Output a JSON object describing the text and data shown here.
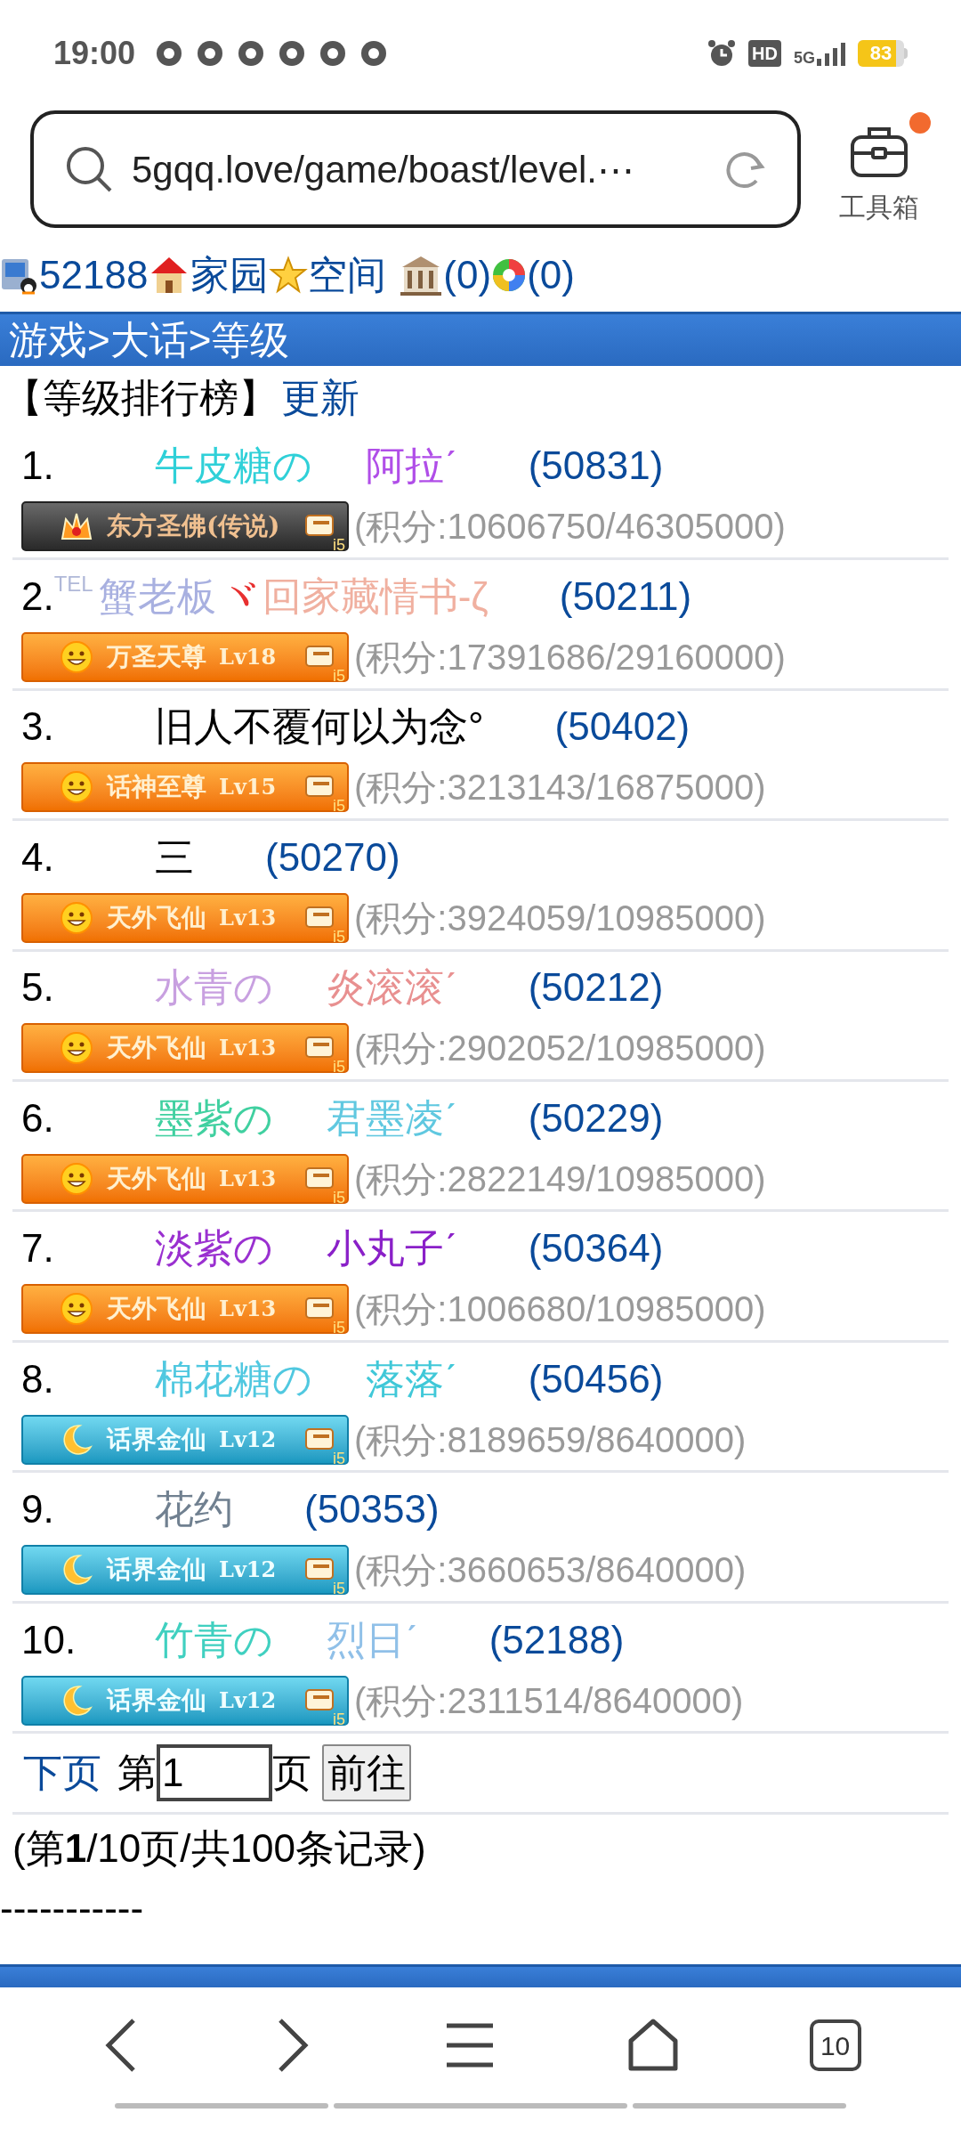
{
  "status_bar": {
    "time": "19:00",
    "hd": "HD",
    "network": "5G",
    "battery": "83"
  },
  "browser": {
    "url": "5gqq.love/game/boast/level.⋯",
    "toolbox": "工具箱",
    "toolbox_dot": true
  },
  "nav": {
    "user_id": "52188",
    "home": "家园",
    "space": "空间",
    "count_a": "(0)",
    "count_b": "(0)"
  },
  "breadcrumb": "游戏>大话>等级",
  "heading": {
    "title": "【等级排行榜】",
    "link": "更新"
  },
  "rows": [
    {
      "rank": "1.",
      "name": [
        {
          "text": "牛皮糖の",
          "color": "#2fd0d8"
        },
        {
          "text": "阿拉ˊ",
          "color": "#b04ee8"
        }
      ],
      "uid": "(50831)",
      "badge": {
        "kind": "dark",
        "title": "东方圣佛(传说)",
        "corner": "i5"
      },
      "score": "(积分:10606750/46305000)"
    },
    {
      "rank": "2.",
      "prefix": "TEL",
      "name": [
        {
          "text": "蟹老板",
          "color": "#a8b0e0"
        },
        {
          "text": "ヾ",
          "color": "#e83030"
        },
        {
          "text": "回家藏情书-ζ",
          "color": "#f0b0a0"
        }
      ],
      "uid": "(50211)",
      "badge": {
        "kind": "orange",
        "title": "万圣天尊",
        "level": "Lv18",
        "corner": "i5"
      },
      "score": "(积分:17391686/29160000)"
    },
    {
      "rank": "3.",
      "name": [
        {
          "text": "旧人不覆何以为念°",
          "color": "#000000"
        }
      ],
      "uid": "(50402)",
      "badge": {
        "kind": "orange",
        "title": "话神至尊",
        "level": "Lv15",
        "corner": "i5"
      },
      "score": "(积分:3213143/16875000)"
    },
    {
      "rank": "4.",
      "name": [
        {
          "text": "三",
          "color": "#000000"
        }
      ],
      "uid": "(50270)",
      "badge": {
        "kind": "orange",
        "title": "天外飞仙",
        "level": "Lv13",
        "corner": "i5"
      },
      "score": "(积分:3924059/10985000)"
    },
    {
      "rank": "5.",
      "name": [
        {
          "text": "水青の",
          "color": "#c8a0e0"
        },
        {
          "text": "炎滚滚ˊ",
          "color": "#e89090"
        }
      ],
      "uid": "(50212)",
      "badge": {
        "kind": "orange",
        "title": "天外飞仙",
        "level": "Lv13",
        "corner": "i5"
      },
      "score": "(积分:2902052/10985000)"
    },
    {
      "rank": "6.",
      "name": [
        {
          "text": "墨紫の",
          "color": "#40d0a0"
        },
        {
          "text": "君墨凌ˊ",
          "color": "#60c8e0"
        }
      ],
      "uid": "(50229)",
      "badge": {
        "kind": "orange",
        "title": "天外飞仙",
        "level": "Lv13",
        "corner": "i5"
      },
      "score": "(积分:2822149/10985000)"
    },
    {
      "rank": "7.",
      "name": [
        {
          "text": "淡紫の",
          "color": "#9a30d0"
        },
        {
          "text": "小丸子ˊ",
          "color": "#8a20c8"
        }
      ],
      "uid": "(50364)",
      "badge": {
        "kind": "orange",
        "title": "天外飞仙",
        "level": "Lv13",
        "corner": "i5"
      },
      "score": "(积分:1006680/10985000)"
    },
    {
      "rank": "8.",
      "name": [
        {
          "text": "棉花糖の",
          "color": "#50c8e0"
        },
        {
          "text": "落落ˊ",
          "color": "#40c8d8"
        }
      ],
      "uid": "(50456)",
      "badge": {
        "kind": "blue",
        "title": "话界金仙",
        "level": "Lv12",
        "corner": "i5"
      },
      "score": "(积分:8189659/8640000)"
    },
    {
      "rank": "9.",
      "name": [
        {
          "text": "花约",
          "color": "#708090"
        }
      ],
      "uid": "(50353)",
      "badge": {
        "kind": "blue",
        "title": "话界金仙",
        "level": "Lv12",
        "corner": "i5"
      },
      "score": "(积分:3660653/8640000)"
    },
    {
      "rank": "10.",
      "name": [
        {
          "text": "竹青の",
          "color": "#40d0c0"
        },
        {
          "text": "烈日ˊ",
          "color": "#90c0e8"
        }
      ],
      "uid": "(52188)",
      "badge": {
        "kind": "blue",
        "title": "话界金仙",
        "level": "Lv12",
        "corner": "i5"
      },
      "score": "(积分:2311514/8640000)"
    }
  ],
  "pager": {
    "next": "下页",
    "before": "第",
    "value": "1",
    "after": "页",
    "go": "前往"
  },
  "summary": "(第**1**/10页/共100条记录)",
  "dashes": "-----------",
  "bottom_bar": {
    "tabs": "10"
  }
}
